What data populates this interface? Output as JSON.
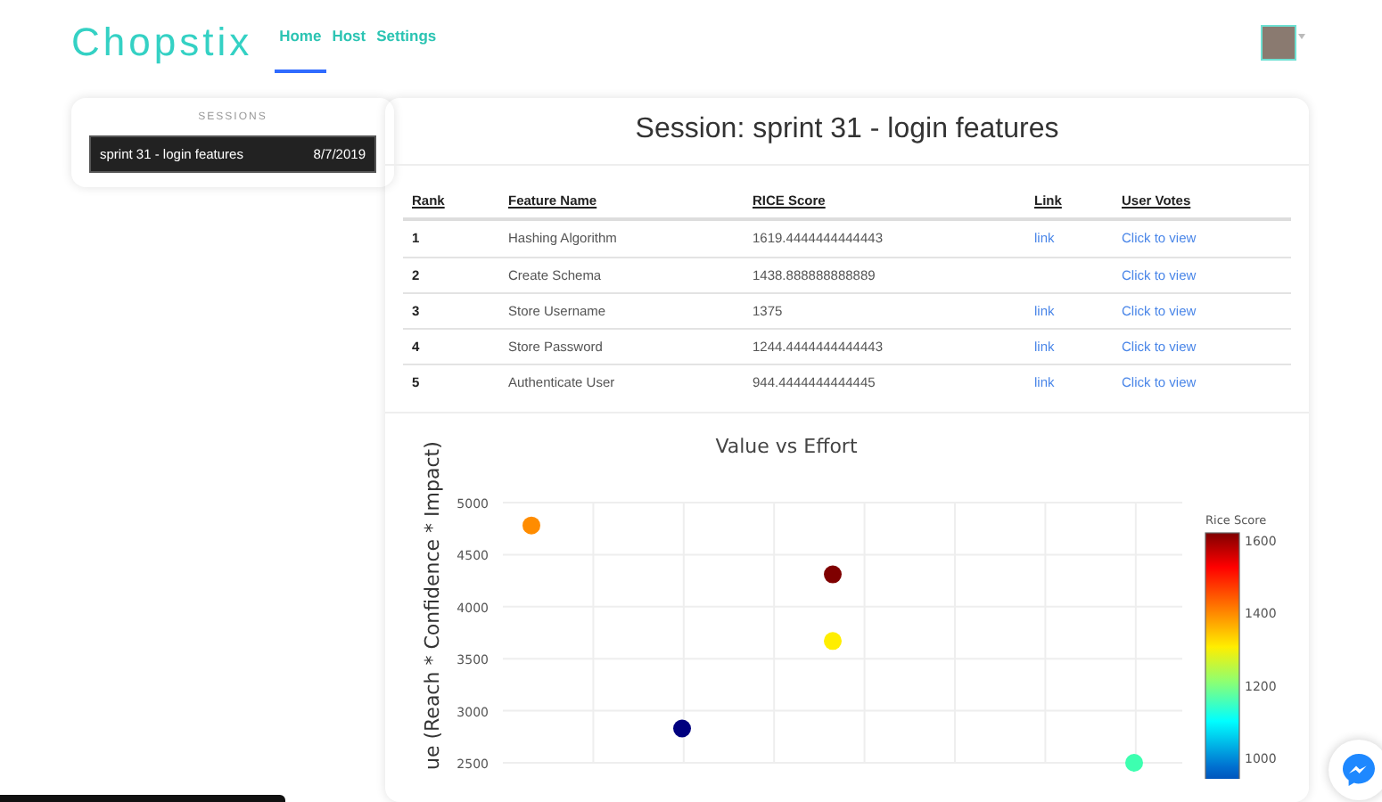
{
  "navbar": {
    "logo": "Chopstix",
    "links": [
      {
        "label": "Home",
        "selected": true
      },
      {
        "label": "Host",
        "selected": false
      },
      {
        "label": "Settings",
        "selected": false
      }
    ]
  },
  "sidebar": {
    "heading": "SESSIONS",
    "items": [
      {
        "name": "sprint 31 - login features",
        "date": "8/7/2019",
        "selected": true
      }
    ]
  },
  "session": {
    "title": "Session: sprint 31 - login features",
    "table": {
      "columns": [
        "Rank",
        "Feature Name",
        "RICE Score",
        "Link",
        "User Votes"
      ],
      "rows": [
        {
          "rank": "1",
          "feature": "Hashing Algorithm",
          "score": "1619.4444444444443",
          "link": "link",
          "votes": "Click to view"
        },
        {
          "rank": "2",
          "feature": "Create Schema",
          "score": "1438.888888888889",
          "votes": "Click to view"
        },
        {
          "rank": "3",
          "feature": "Store Username",
          "score": "1375",
          "link": "link",
          "votes": "Click to view"
        },
        {
          "rank": "4",
          "feature": "Store Password",
          "score": "1244.4444444444443",
          "link": "link",
          "votes": "Click to view"
        },
        {
          "rank": "5",
          "feature": "Authenticate User",
          "score": "944.4444444444445",
          "link": "link",
          "votes": "Click to view"
        }
      ]
    },
    "chart_data": {
      "type": "scatter",
      "title": "Value vs Effort",
      "ylabel": "ue (Reach * Confidence * Impact)",
      "ylim": [
        2500,
        5000
      ],
      "yticks": [
        2500,
        3000,
        3500,
        4000,
        4500,
        5000
      ],
      "grid": true,
      "categories": [
        null,
        null,
        null,
        null,
        null
      ],
      "series": [
        {
          "color": "#ff8c00",
          "values": [
            4780,
            null,
            null,
            null,
            null
          ]
        },
        {
          "color": "#00007f",
          "values": [
            null,
            2830,
            null,
            null,
            null
          ]
        },
        {
          "color": "#7f0000",
          "values": [
            null,
            null,
            4310,
            null,
            null
          ]
        },
        {
          "color": "#ffee00",
          "values": [
            null,
            null,
            3670,
            null,
            null
          ]
        },
        {
          "color": "#3dffb0",
          "values": [
            null,
            null,
            null,
            null,
            2500
          ]
        }
      ]
    },
    "colorbar": {
      "title": "Rice Score",
      "ticks": [
        "1600",
        "1400",
        "1200",
        "1000"
      ]
    }
  }
}
